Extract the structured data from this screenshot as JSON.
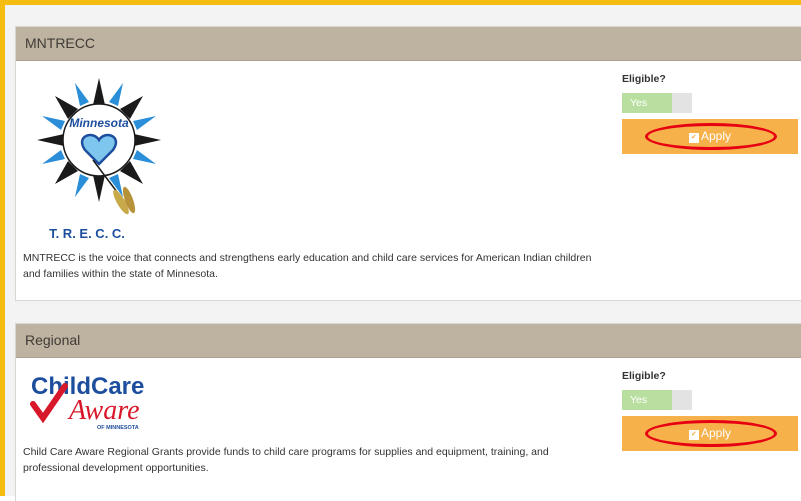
{
  "panels": [
    {
      "heading": "MNTRECC",
      "logo_text": {
        "top": "Minnesota",
        "bottom": "T. R. E. C. C."
      },
      "description": "MNTRECC is the voice that connects and strengthens early education and child care services for American Indian children and families within the state of Minnesota.",
      "eligible_label": "Eligible?",
      "eligible_value": "Yes",
      "apply_label": "Apply"
    },
    {
      "heading": "Regional",
      "logo_text": {
        "line1": "ChildCare",
        "line2": "Aware",
        "line3": "OF MINNESOTA"
      },
      "description": "Child Care Aware Regional Grants provide funds to child care programs for supplies and equipment, training, and professional development opportunities.",
      "eligible_label": "Eligible?",
      "eligible_value": "Yes",
      "apply_label": "Apply"
    }
  ],
  "colors": {
    "frame": "#f5bd10",
    "heading_bg": "#bdb3a0",
    "apply_bg": "#f7b14b",
    "toggle_on": "#b9dfa0",
    "highlight_ring": "#e60012"
  },
  "icons": {
    "apply": "check-square-icon"
  }
}
